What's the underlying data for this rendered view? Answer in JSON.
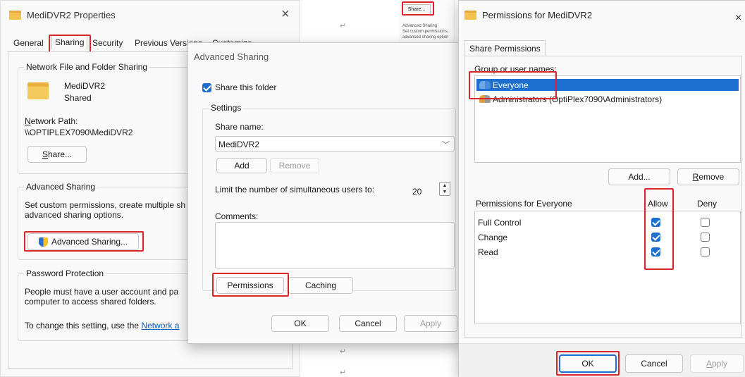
{
  "properties_window": {
    "title": "MediDVR2 Properties",
    "close_glyph": "×",
    "tabs": [
      "General",
      "Sharing",
      "Security",
      "Previous Versions",
      "Customize"
    ],
    "network_sharing": {
      "group_title": "Network File and Folder Sharing",
      "folder_name": "MediDVR2",
      "folder_status": "Shared",
      "network_path_label": "Network Path:",
      "network_path": "\\\\OPTIPLEX7090\\MediDVR2",
      "share_button": "Share..."
    },
    "advanced_sharing": {
      "group_title": "Advanced Sharing",
      "description_line1": "Set custom permissions, create multiple sh",
      "description_line2": "advanced sharing options.",
      "button": "Advanced Sharing..."
    },
    "password_protection": {
      "group_title": "Password Protection",
      "text_line1": "People must have a user account and pa",
      "text_line2": "computer to access shared folders.",
      "change_text": "To change this setting, use the",
      "link_text": "Network a"
    }
  },
  "background_doc": {
    "share_label": "Share...",
    "small_text_1": "Advanced Sharing",
    "small_text_2": "Set custom permissions,",
    "small_text_3": "advanced sharing option",
    "return_glyph": "↵"
  },
  "advanced_window": {
    "title": "Advanced Sharing",
    "share_this_folder": "Share this folder",
    "settings_title": "Settings",
    "share_name_label": "Share name:",
    "share_name_value": "MediDVR2",
    "add_button": "Add",
    "remove_button": "Remove",
    "limit_label": "Limit the number of simultaneous users to:",
    "limit_value": "20",
    "comments_label": "Comments:",
    "permissions_button": "Permissions",
    "caching_button": "Caching",
    "ok_button": "OK",
    "cancel_button": "Cancel",
    "apply_button": "Apply"
  },
  "permissions_window": {
    "title": "Permissions for MediDVR2",
    "close_glyph": "×",
    "tab": "Share Permissions",
    "group_label": "Group or user names:",
    "users": [
      {
        "name": "Everyone"
      },
      {
        "name": "Administrators (OptiPlex7090\\Administrators)"
      }
    ],
    "add_button": "Add...",
    "remove_button": "Remove",
    "permissions_for_label": "Permissions for Everyone",
    "allow_header": "Allow",
    "deny_header": "Deny",
    "permissions": [
      {
        "name": "Full Control",
        "allow": true,
        "deny": false
      },
      {
        "name": "Change",
        "allow": true,
        "deny": false
      },
      {
        "name": "Read",
        "allow": true,
        "deny": false
      }
    ],
    "ok_button": "OK",
    "cancel_button": "Cancel",
    "apply_button": "Apply"
  },
  "colors": {
    "highlight_red": "#d9262a",
    "selection_blue": "#1f6fd1",
    "folder_yellow": "#f2c14e",
    "link_blue": "#0a5ac2"
  }
}
